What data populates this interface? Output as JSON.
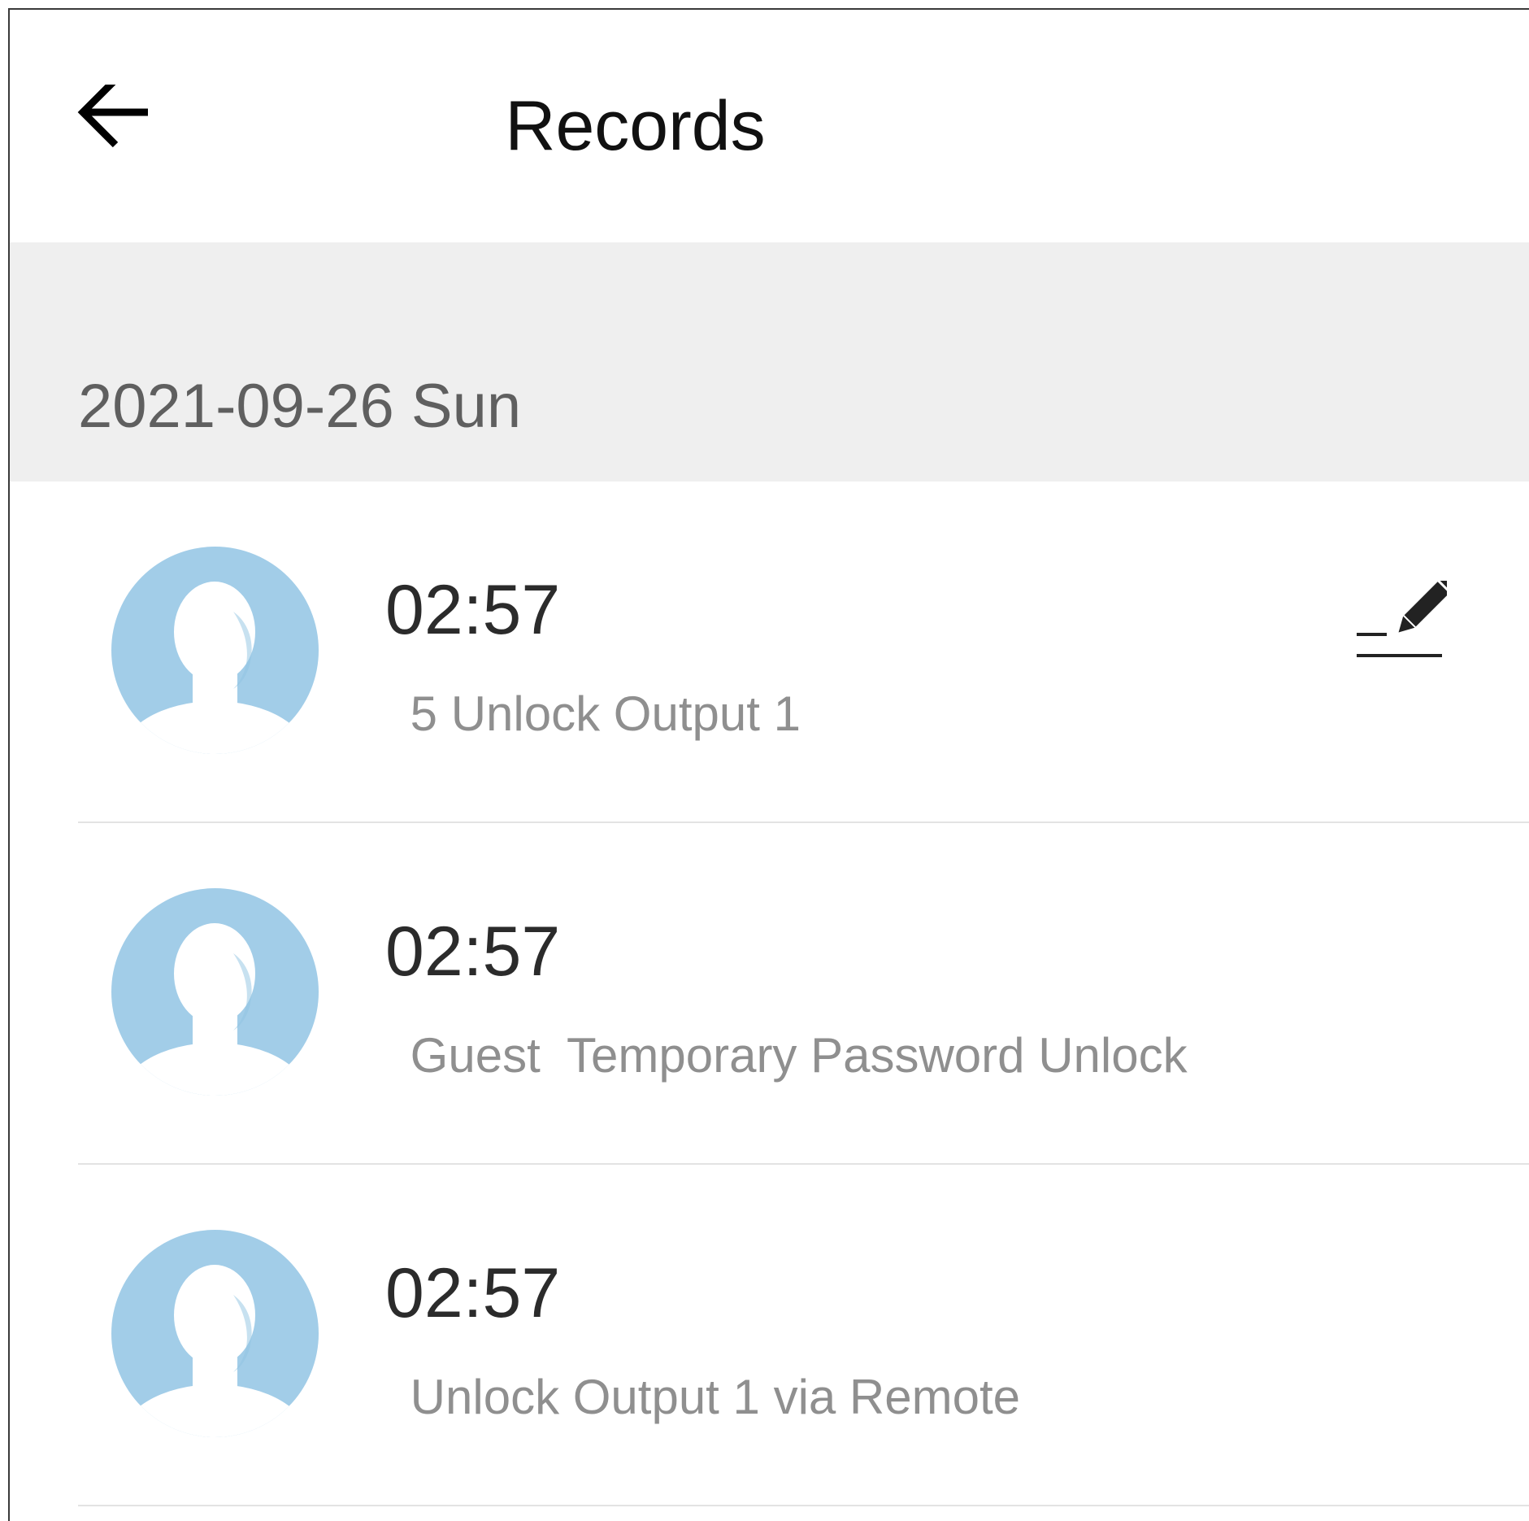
{
  "header": {
    "title": "Records",
    "back_icon": "arrow-left-icon"
  },
  "date_section": {
    "label": "2021-09-26 Sun"
  },
  "records": [
    {
      "time": "02:57",
      "description": " 5 Unlock Output 1",
      "avatar_icon": "user-avatar-icon",
      "has_edit": true,
      "edit_icon": "edit-pencil-icon"
    },
    {
      "time": "02:57",
      "description": " Guest  Temporary Password Unlock",
      "avatar_icon": "user-avatar-icon",
      "has_edit": false
    },
    {
      "time": "02:57",
      "description": " Unlock Output 1 via Remote",
      "avatar_icon": "user-avatar-icon",
      "has_edit": false
    }
  ],
  "colors": {
    "avatar_blue": "#a2cde8",
    "band_gray": "#efefef",
    "title_text": "#111111",
    "secondary_text": "#8f8f8f"
  }
}
